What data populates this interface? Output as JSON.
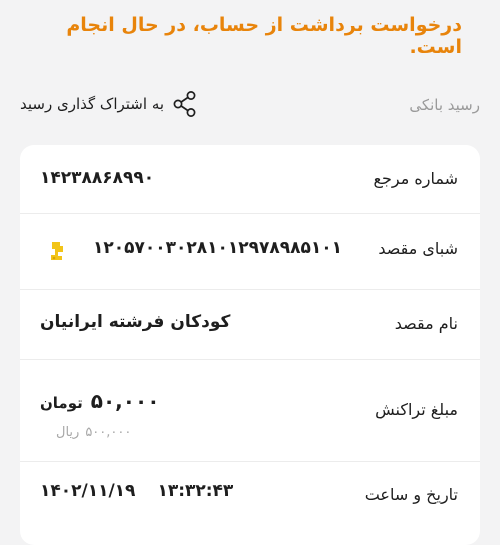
{
  "status_message": "درخواست برداشت از حساب، در حال انجام است.",
  "header": {
    "receipt_title": "رسید بانکی",
    "share_label": "به اشتراک گذاری رسید",
    "share_icon": "share-icon"
  },
  "receipt": {
    "reference": {
      "label": "شماره مرجع",
      "value": "۱۴۲۳۸۸۶۸۹۹۰"
    },
    "destination_sheba": {
      "label": "شبای مقصد",
      "value": "۱۲۰۵۷۰۰۳۰۲۸۱۰۱۲۹۷۸۹۸۵۱۰۱",
      "bank_icon": "bank-logo-icon"
    },
    "destination_name": {
      "label": "نام مقصد",
      "value": "کودکان فرشته ایرانیان"
    },
    "amount": {
      "label": "مبلغ تراکنش",
      "value_toman": "۵۰,۰۰۰",
      "unit_toman": "تومان",
      "value_rial": "۵۰۰,۰۰۰",
      "unit_rial": "ریال"
    },
    "datetime": {
      "label": "تاریخ و ساعت",
      "date": "۱۴۰۲/۱۱/۱۹",
      "time": "۱۳:۳۲:۴۳"
    }
  },
  "colors": {
    "accent": "#e8840b",
    "background": "#f3f3f4",
    "card": "#ffffff",
    "muted_text": "#9a9a9a",
    "bank_logo": "#f2c418"
  }
}
